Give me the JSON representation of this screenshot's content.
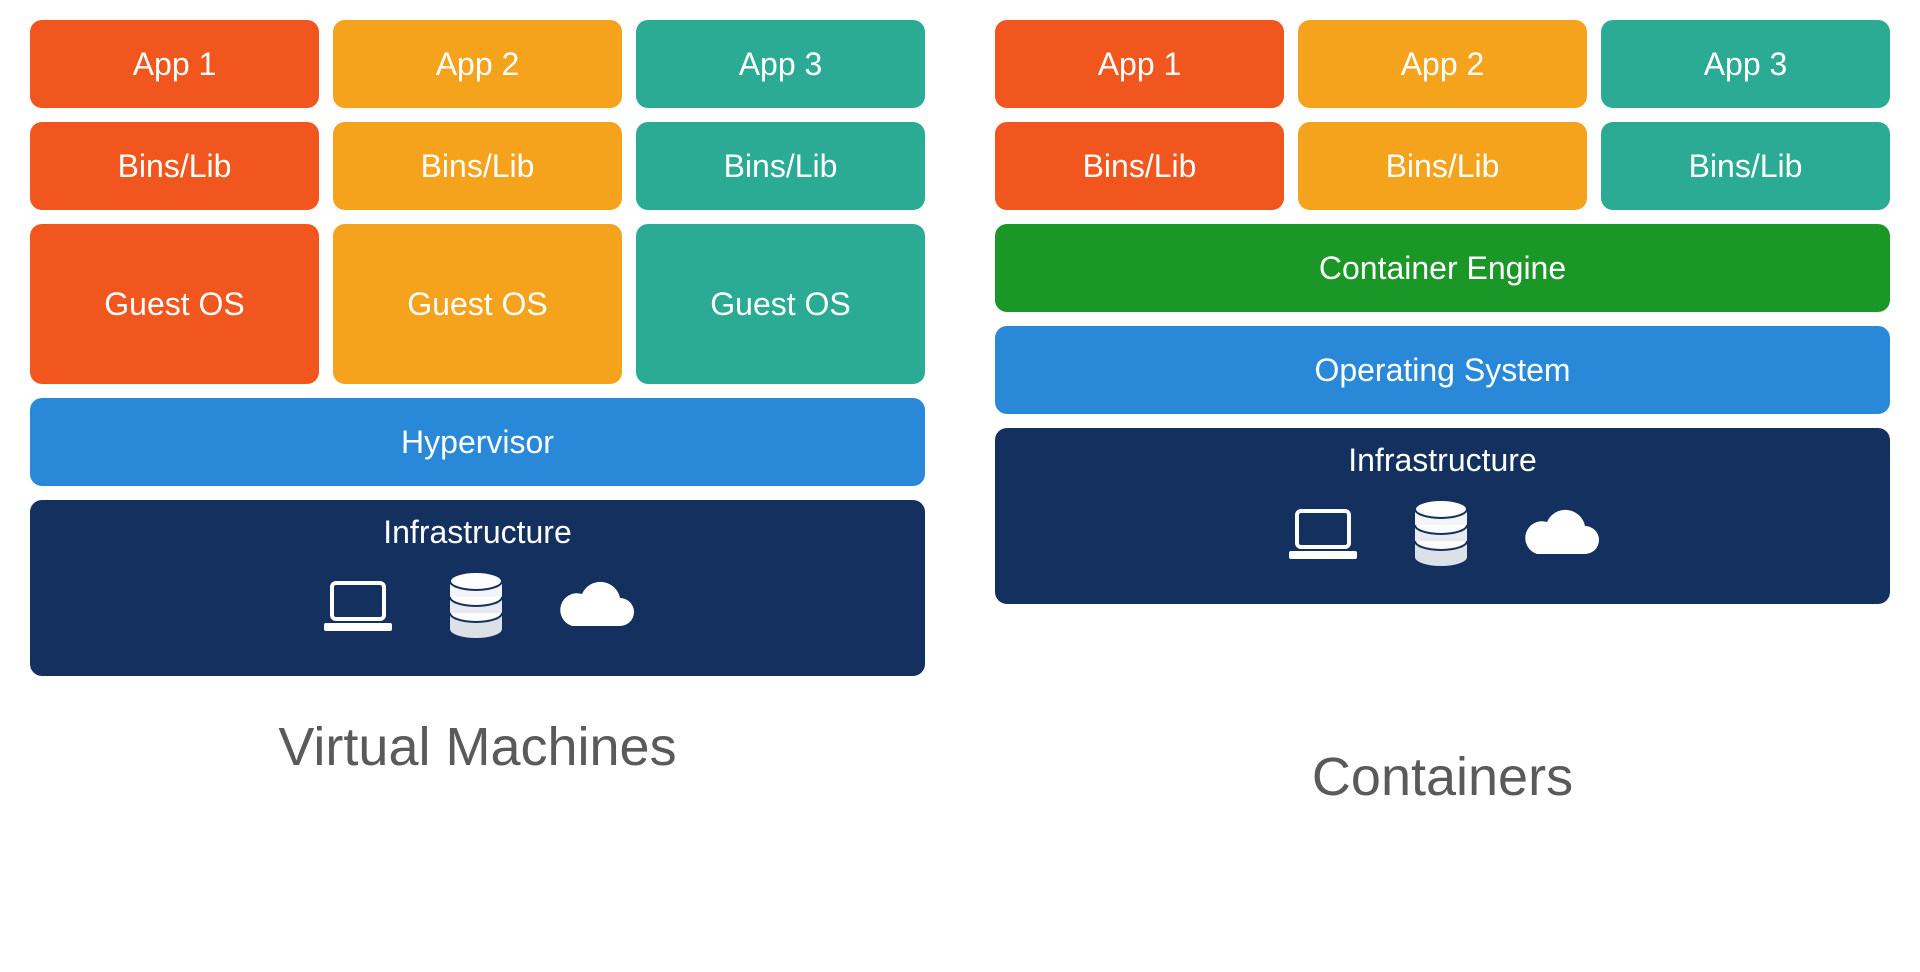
{
  "vm": {
    "apps": [
      "App 1",
      "App 2",
      "App 3"
    ],
    "bins": [
      "Bins/Lib",
      "Bins/Lib",
      "Bins/Lib"
    ],
    "guest": [
      "Guest OS",
      "Guest OS",
      "Guest OS"
    ],
    "hypervisor": "Hypervisor",
    "infra": "Infrastructure",
    "title": "Virtual Machines"
  },
  "ct": {
    "apps": [
      "App 1",
      "App 2",
      "App 3"
    ],
    "bins": [
      "Bins/Lib",
      "Bins/Lib",
      "Bins/Lib"
    ],
    "engine": "Container Engine",
    "os": "Operating System",
    "infra": "Infrastructure",
    "title": "Containers"
  },
  "colors": {
    "red": "#f0561d",
    "orange": "#f5a21c",
    "teal": "#2bab94",
    "green": "#1b9728",
    "blue": "#2989d8",
    "navy": "#14305e"
  }
}
